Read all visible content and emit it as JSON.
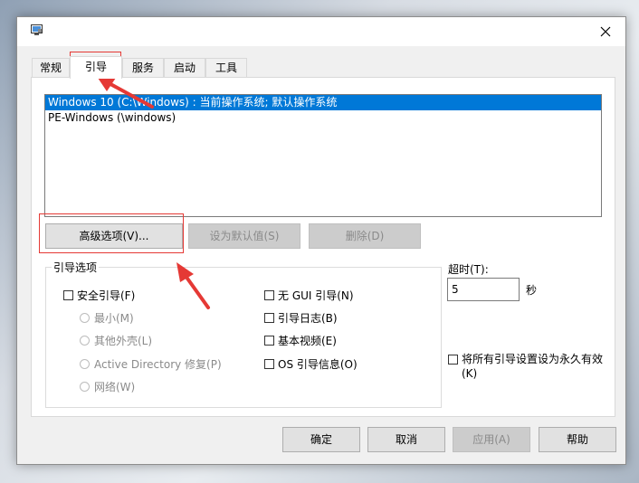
{
  "window": {
    "icon": "msconfig-icon",
    "close": "close-icon"
  },
  "tabs": [
    {
      "label": "常规"
    },
    {
      "label": "引导",
      "active": true
    },
    {
      "label": "服务"
    },
    {
      "label": "启动"
    },
    {
      "label": "工具"
    }
  ],
  "os_list": [
    {
      "label": "Windows 10 (C:\\Windows) : 当前操作系统; 默认操作系统",
      "selected": true
    },
    {
      "label": "PE-Windows (\\windows)",
      "selected": false
    }
  ],
  "list_buttons": {
    "advanced": "高级选项(V)...",
    "set_default": "设为默认值(S)",
    "delete": "删除(D)"
  },
  "boot_options": {
    "title": "引导选项",
    "safe_boot": "安全引导(F)",
    "minimal": "最小(M)",
    "alternate_shell": "其他外壳(L)",
    "ad_repair": "Active Directory 修复(P)",
    "network": "网络(W)",
    "no_gui": "无 GUI 引导(N)",
    "boot_log": "引导日志(B)",
    "base_video": "基本视频(E)",
    "os_info": "OS 引导信息(O)"
  },
  "timeout": {
    "label": "超时(T):",
    "value": "5",
    "unit": "秒"
  },
  "make_permanent": "将所有引导设置设为永久有效(K)",
  "footer": {
    "ok": "确定",
    "cancel": "取消",
    "apply": "应用(A)",
    "help": "帮助"
  },
  "colors": {
    "selection": "#0078d7",
    "annotation": "#e53935"
  }
}
